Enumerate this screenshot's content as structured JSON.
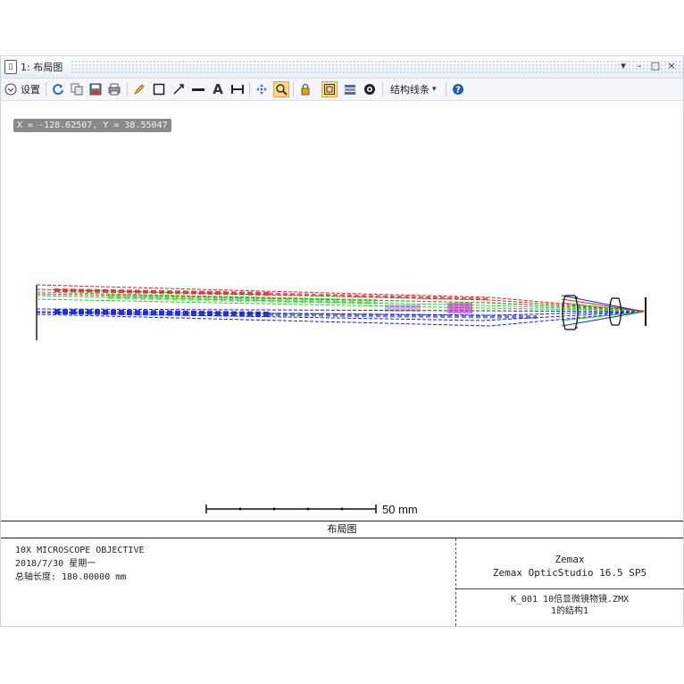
{
  "window": {
    "title": "1: 布局图",
    "controls": {
      "dropdown": "▾",
      "minimize": "–",
      "maximize": "□",
      "close": "×"
    }
  },
  "toolbar": {
    "settings_label": "设置",
    "tools_label": "结构线条",
    "tool_icons": [
      "refresh-icon",
      "copy-icon",
      "save-icon",
      "print-icon",
      "pencil-icon",
      "rectangle-icon",
      "arrow-icon",
      "line-icon",
      "text-icon",
      "dimension-icon",
      "pan-icon",
      "zoom-icon",
      "lock-icon",
      "fit-icon",
      "layers-icon",
      "camera-icon",
      "help-icon"
    ]
  },
  "coordinates_readout": "X = -128.62507, Y = 38.55047",
  "scale_bar_label": "50 mm",
  "layout_label": "布局图",
  "info": {
    "left_line1": "10X MICROSCOPE OBJECTIVE",
    "left_line2": "2018/7/30 星期一",
    "left_line3": "总轴长度:  180.00000 mm",
    "right_line1": "Zemax",
    "right_line2": "Zemax OpticStudio 16.5 SP5",
    "right_line3": "K_001 10倍显微镜物镜.ZMX",
    "right_line4": "1的结构1"
  },
  "colors": {
    "ray_red": "#e02020",
    "ray_green": "#22cc22",
    "ray_blue": "#1020e0",
    "ray_magenta": "#c020c0",
    "selected_tool": "#ffd98a"
  }
}
